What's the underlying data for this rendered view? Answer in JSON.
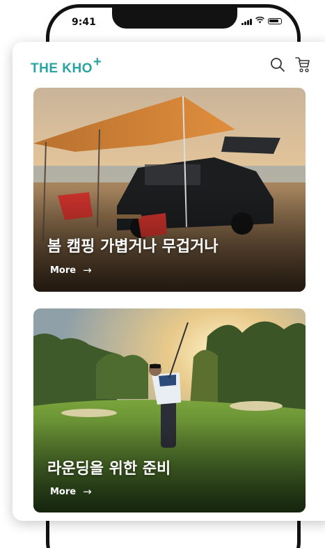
{
  "status_bar": {
    "time": "9:41"
  },
  "header": {
    "logo_text": "THE KHO",
    "logo_plus": "+",
    "icons": [
      "search-icon",
      "cart-icon"
    ]
  },
  "banners": [
    {
      "title": "봄 캠핑 가볍거나 무겁거나",
      "more_label": "More",
      "arrow": "→"
    },
    {
      "title": "라운딩을 위한 준비",
      "more_label": "More",
      "arrow": "→"
    }
  ],
  "colors": {
    "brand": "#2aa3a3",
    "frame": "#121212"
  }
}
